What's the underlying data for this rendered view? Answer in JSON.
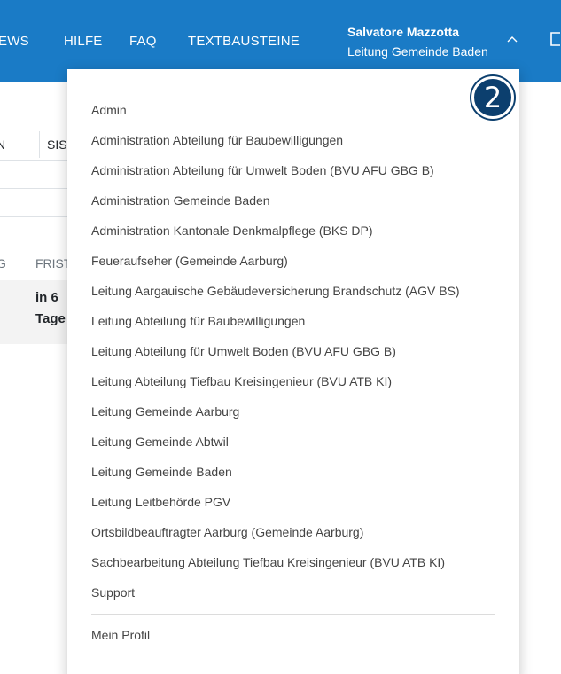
{
  "nav": {
    "items": [
      "EWS",
      "HILFE",
      "FAQ",
      "TEXTBAUSTEINE"
    ],
    "user_name": "Salvatore Mazzotta",
    "user_role": "Leitung Gemeinde Baden"
  },
  "background": {
    "tab_n": "N",
    "tab_sis": "SIS",
    "tab_g": "G",
    "tab_frist": "FRIST",
    "deadline_line1": "in 6",
    "deadline_line2": "Tage"
  },
  "menu": {
    "items": [
      "Admin",
      "Administration Abteilung für Baubewilligungen",
      "Administration Abteilung für Umwelt Boden (BVU AFU GBG B)",
      "Administration Gemeinde Baden",
      "Administration Kantonale Denkmalpflege (BKS DP)",
      "Feueraufseher (Gemeinde Aarburg)",
      "Leitung Aargauische Gebäudeversicherung Brandschutz (AGV BS)",
      "Leitung Abteilung für Baubewilligungen",
      "Leitung Abteilung für Umwelt Boden (BVU AFU GBG B)",
      "Leitung Abteilung Tiefbau Kreisingenieur (BVU ATB KI)",
      "Leitung Gemeinde Aarburg",
      "Leitung Gemeinde Abtwil",
      "Leitung Gemeinde Baden",
      "Leitung Leitbehörde PGV",
      "Ortsbildbeauftragter Aarburg (Gemeinde Aarburg)",
      "Sachbearbeitung Abteilung Tiefbau Kreisingenieur (BVU ATB KI)",
      "Support"
    ],
    "profile": "Mein Profil"
  },
  "badge": {
    "number": "2"
  },
  "colors": {
    "navbar": "#1a7bc6",
    "badge": "#0c3f6e"
  }
}
